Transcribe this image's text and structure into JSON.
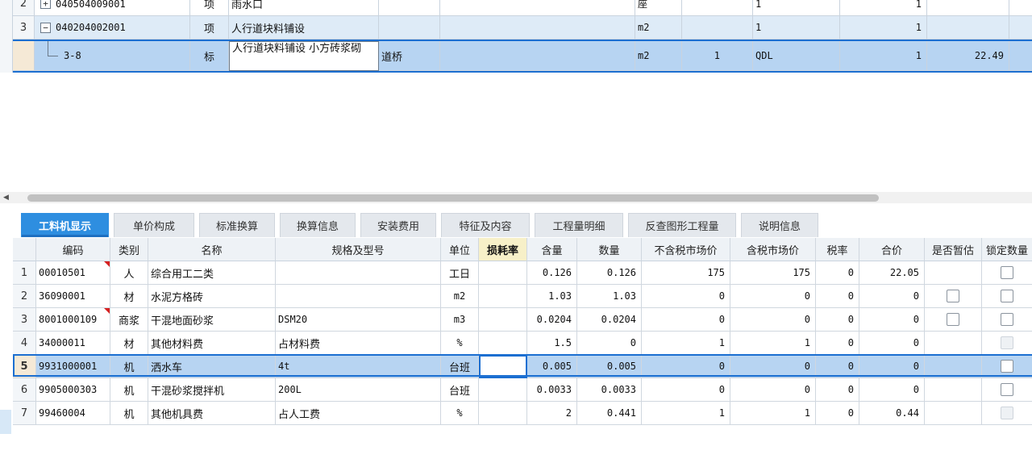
{
  "top_grid": {
    "rows": [
      {
        "num": "2",
        "toggle": "+",
        "code": "040504009001",
        "type": "项",
        "name": "雨水口",
        "profession": "",
        "unit": "座",
        "qty_expr": "",
        "qty_code": "1",
        "qty": "1",
        "price": ""
      },
      {
        "num": "3",
        "toggle": "−",
        "code": "040204002001",
        "type": "项",
        "name": "人行道块料铺设",
        "profession": "",
        "unit": "m2",
        "qty_expr": "",
        "qty_code": "1",
        "qty": "1",
        "price": ""
      },
      {
        "num": "",
        "toggle": "",
        "code": "3-8",
        "type": "标",
        "name": "人行道块料铺设 小方砖浆砌",
        "profession": "道桥",
        "unit": "m2",
        "qty_expr": "1",
        "qty_code": "QDL",
        "qty": "1",
        "price": "22.49"
      }
    ]
  },
  "tabs": [
    "工料机显示",
    "单价构成",
    "标准换算",
    "换算信息",
    "安装费用",
    "特征及内容",
    "工程量明细",
    "反查图形工程量",
    "说明信息"
  ],
  "table": {
    "headers": [
      "编码",
      "类别",
      "名称",
      "规格及型号",
      "单位",
      "损耗率",
      "含量",
      "数量",
      "不含税市场价",
      "含税市场价",
      "税率",
      "合价",
      "是否暂估",
      "锁定数量"
    ],
    "rows": [
      {
        "num": "1",
        "code": "00010501",
        "type": "人",
        "name": "综合用工二类",
        "spec": "",
        "unit": "工日",
        "loss": "",
        "content": "0.126",
        "qty": "0.126",
        "price_ex": "175",
        "price_in": "175",
        "tax": "0",
        "total": "22.05",
        "estimate": "none",
        "lock": "box"
      },
      {
        "num": "2",
        "code": "36090001",
        "type": "材",
        "name": "水泥方格砖",
        "spec": "",
        "unit": "m2",
        "loss": "",
        "content": "1.03",
        "qty": "1.03",
        "price_ex": "0",
        "price_in": "0",
        "tax": "0",
        "total": "0",
        "estimate": "box",
        "lock": "box"
      },
      {
        "num": "3",
        "code": "8001000109",
        "type": "商浆",
        "name": "干混地面砂浆",
        "spec": "DSM20",
        "unit": "m3",
        "loss": "",
        "content": "0.0204",
        "qty": "0.0204",
        "price_ex": "0",
        "price_in": "0",
        "tax": "0",
        "total": "0",
        "estimate": "box",
        "lock": "box"
      },
      {
        "num": "4",
        "code": "34000011",
        "type": "材",
        "name": "其他材料费",
        "spec": "占材料费",
        "unit": "%",
        "loss": "",
        "content": "1.5",
        "qty": "0",
        "price_ex": "1",
        "price_in": "1",
        "tax": "0",
        "total": "0",
        "estimate": "none",
        "lock": "disabled"
      },
      {
        "num": "5",
        "code": "9931000001",
        "type": "机",
        "name": "洒水车",
        "spec": "4t",
        "unit": "台班",
        "loss": "",
        "content": "0.005",
        "qty": "0.005",
        "price_ex": "0",
        "price_in": "0",
        "tax": "0",
        "total": "0",
        "estimate": "none",
        "lock": "box"
      },
      {
        "num": "6",
        "code": "9905000303",
        "type": "机",
        "name": "干混砂浆搅拌机",
        "spec": "200L",
        "unit": "台班",
        "loss": "",
        "content": "0.0033",
        "qty": "0.0033",
        "price_ex": "0",
        "price_in": "0",
        "tax": "0",
        "total": "0",
        "estimate": "none",
        "lock": "box"
      },
      {
        "num": "7",
        "code": "99460004",
        "type": "机",
        "name": "其他机具费",
        "spec": "占人工费",
        "unit": "%",
        "loss": "",
        "content": "2",
        "qty": "0.441",
        "price_ex": "1",
        "price_in": "1",
        "tax": "0",
        "total": "0.44",
        "estimate": "none",
        "lock": "disabled"
      }
    ]
  }
}
